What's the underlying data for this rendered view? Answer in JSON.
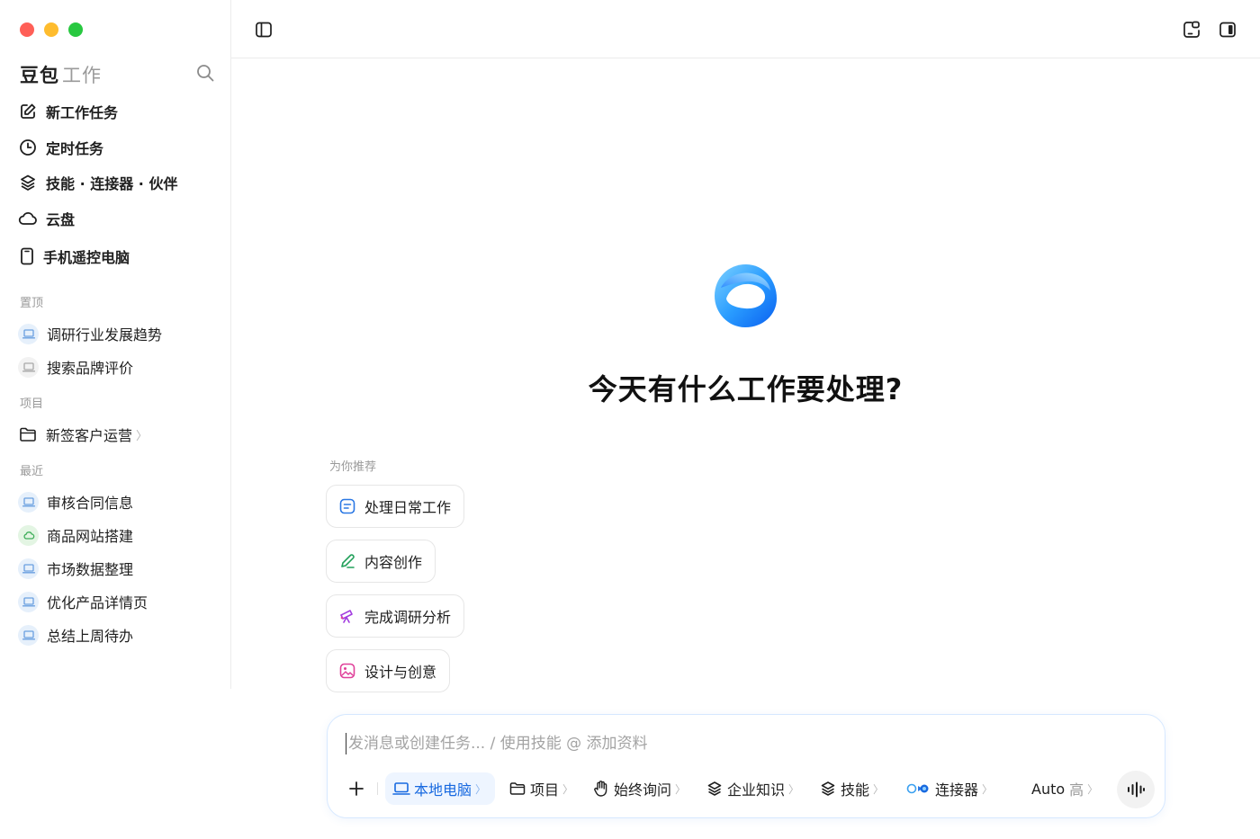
{
  "sidebar": {
    "brand": "豆包",
    "brand_sub": "工作",
    "nav": [
      {
        "label": "新工作任务",
        "icon": "edit-icon"
      },
      {
        "label": "定时任务",
        "icon": "clock-icon"
      },
      {
        "label": "技能 · 连接器 · 伙伴",
        "icon": "layers-icon"
      },
      {
        "label": "云盘",
        "icon": "cloud-icon"
      },
      {
        "label": "手机遥控电脑",
        "icon": "phone-icon"
      }
    ],
    "pinned_label": "置顶",
    "pinned": [
      {
        "label": "调研行业发展趋势"
      },
      {
        "label": "搜索品牌评价"
      }
    ],
    "projects_label": "项目",
    "projects": [
      {
        "label": "新签客户运营",
        "chevron": "〉"
      }
    ],
    "recent_label": "最近",
    "recent": [
      {
        "label": "审核合同信息"
      },
      {
        "label": "商品网站搭建"
      },
      {
        "label": "市场数据整理"
      },
      {
        "label": "优化产品详情页"
      },
      {
        "label": "总结上周待办"
      }
    ]
  },
  "main": {
    "headline": "今天有什么工作要处理?",
    "recommend_label": "为你推荐",
    "chips": [
      {
        "label": "处理日常工作",
        "icon": "task-icon",
        "color": "#2b78e4"
      },
      {
        "label": "内容创作",
        "icon": "pen-icon",
        "color": "#22a05a"
      },
      {
        "label": "完成调研分析",
        "icon": "telescope-icon",
        "color": "#a33ee0"
      },
      {
        "label": "设计与创意",
        "icon": "image-icon",
        "color": "#e0409a"
      }
    ]
  },
  "composer": {
    "placeholder": "发消息或创建任务... / 使用技能 @ 添加资料",
    "tools": {
      "local": "本地电脑",
      "project": "项目",
      "ask": "始终询问",
      "knowledge": "企业知识",
      "skills": "技能",
      "connectors": "连接器",
      "model": "Auto",
      "model_level": "高",
      "chevron": "〉"
    }
  },
  "colors": {
    "accent": "#1769e0",
    "border": "#ececec",
    "muted": "#9a9a9a"
  }
}
